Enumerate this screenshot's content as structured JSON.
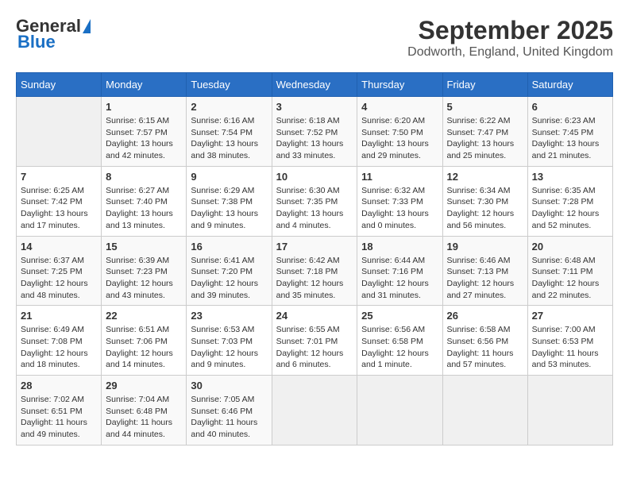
{
  "logo": {
    "general": "General",
    "blue": "Blue"
  },
  "title": "September 2025",
  "subtitle": "Dodworth, England, United Kingdom",
  "days_header": [
    "Sunday",
    "Monday",
    "Tuesday",
    "Wednesday",
    "Thursday",
    "Friday",
    "Saturday"
  ],
  "weeks": [
    [
      {
        "day": "",
        "empty": true
      },
      {
        "day": "1",
        "sunrise": "Sunrise: 6:15 AM",
        "sunset": "Sunset: 7:57 PM",
        "daylight": "Daylight: 13 hours and 42 minutes."
      },
      {
        "day": "2",
        "sunrise": "Sunrise: 6:16 AM",
        "sunset": "Sunset: 7:54 PM",
        "daylight": "Daylight: 13 hours and 38 minutes."
      },
      {
        "day": "3",
        "sunrise": "Sunrise: 6:18 AM",
        "sunset": "Sunset: 7:52 PM",
        "daylight": "Daylight: 13 hours and 33 minutes."
      },
      {
        "day": "4",
        "sunrise": "Sunrise: 6:20 AM",
        "sunset": "Sunset: 7:50 PM",
        "daylight": "Daylight: 13 hours and 29 minutes."
      },
      {
        "day": "5",
        "sunrise": "Sunrise: 6:22 AM",
        "sunset": "Sunset: 7:47 PM",
        "daylight": "Daylight: 13 hours and 25 minutes."
      },
      {
        "day": "6",
        "sunrise": "Sunrise: 6:23 AM",
        "sunset": "Sunset: 7:45 PM",
        "daylight": "Daylight: 13 hours and 21 minutes."
      }
    ],
    [
      {
        "day": "7",
        "sunrise": "Sunrise: 6:25 AM",
        "sunset": "Sunset: 7:42 PM",
        "daylight": "Daylight: 13 hours and 17 minutes."
      },
      {
        "day": "8",
        "sunrise": "Sunrise: 6:27 AM",
        "sunset": "Sunset: 7:40 PM",
        "daylight": "Daylight: 13 hours and 13 minutes."
      },
      {
        "day": "9",
        "sunrise": "Sunrise: 6:29 AM",
        "sunset": "Sunset: 7:38 PM",
        "daylight": "Daylight: 13 hours and 9 minutes."
      },
      {
        "day": "10",
        "sunrise": "Sunrise: 6:30 AM",
        "sunset": "Sunset: 7:35 PM",
        "daylight": "Daylight: 13 hours and 4 minutes."
      },
      {
        "day": "11",
        "sunrise": "Sunrise: 6:32 AM",
        "sunset": "Sunset: 7:33 PM",
        "daylight": "Daylight: 13 hours and 0 minutes."
      },
      {
        "day": "12",
        "sunrise": "Sunrise: 6:34 AM",
        "sunset": "Sunset: 7:30 PM",
        "daylight": "Daylight: 12 hours and 56 minutes."
      },
      {
        "day": "13",
        "sunrise": "Sunrise: 6:35 AM",
        "sunset": "Sunset: 7:28 PM",
        "daylight": "Daylight: 12 hours and 52 minutes."
      }
    ],
    [
      {
        "day": "14",
        "sunrise": "Sunrise: 6:37 AM",
        "sunset": "Sunset: 7:25 PM",
        "daylight": "Daylight: 12 hours and 48 minutes."
      },
      {
        "day": "15",
        "sunrise": "Sunrise: 6:39 AM",
        "sunset": "Sunset: 7:23 PM",
        "daylight": "Daylight: 12 hours and 43 minutes."
      },
      {
        "day": "16",
        "sunrise": "Sunrise: 6:41 AM",
        "sunset": "Sunset: 7:20 PM",
        "daylight": "Daylight: 12 hours and 39 minutes."
      },
      {
        "day": "17",
        "sunrise": "Sunrise: 6:42 AM",
        "sunset": "Sunset: 7:18 PM",
        "daylight": "Daylight: 12 hours and 35 minutes."
      },
      {
        "day": "18",
        "sunrise": "Sunrise: 6:44 AM",
        "sunset": "Sunset: 7:16 PM",
        "daylight": "Daylight: 12 hours and 31 minutes."
      },
      {
        "day": "19",
        "sunrise": "Sunrise: 6:46 AM",
        "sunset": "Sunset: 7:13 PM",
        "daylight": "Daylight: 12 hours and 27 minutes."
      },
      {
        "day": "20",
        "sunrise": "Sunrise: 6:48 AM",
        "sunset": "Sunset: 7:11 PM",
        "daylight": "Daylight: 12 hours and 22 minutes."
      }
    ],
    [
      {
        "day": "21",
        "sunrise": "Sunrise: 6:49 AM",
        "sunset": "Sunset: 7:08 PM",
        "daylight": "Daylight: 12 hours and 18 minutes."
      },
      {
        "day": "22",
        "sunrise": "Sunrise: 6:51 AM",
        "sunset": "Sunset: 7:06 PM",
        "daylight": "Daylight: 12 hours and 14 minutes."
      },
      {
        "day": "23",
        "sunrise": "Sunrise: 6:53 AM",
        "sunset": "Sunset: 7:03 PM",
        "daylight": "Daylight: 12 hours and 9 minutes."
      },
      {
        "day": "24",
        "sunrise": "Sunrise: 6:55 AM",
        "sunset": "Sunset: 7:01 PM",
        "daylight": "Daylight: 12 hours and 6 minutes."
      },
      {
        "day": "25",
        "sunrise": "Sunrise: 6:56 AM",
        "sunset": "Sunset: 6:58 PM",
        "daylight": "Daylight: 12 hours and 1 minute."
      },
      {
        "day": "26",
        "sunrise": "Sunrise: 6:58 AM",
        "sunset": "Sunset: 6:56 PM",
        "daylight": "Daylight: 11 hours and 57 minutes."
      },
      {
        "day": "27",
        "sunrise": "Sunrise: 7:00 AM",
        "sunset": "Sunset: 6:53 PM",
        "daylight": "Daylight: 11 hours and 53 minutes."
      }
    ],
    [
      {
        "day": "28",
        "sunrise": "Sunrise: 7:02 AM",
        "sunset": "Sunset: 6:51 PM",
        "daylight": "Daylight: 11 hours and 49 minutes."
      },
      {
        "day": "29",
        "sunrise": "Sunrise: 7:04 AM",
        "sunset": "Sunset: 6:48 PM",
        "daylight": "Daylight: 11 hours and 44 minutes."
      },
      {
        "day": "30",
        "sunrise": "Sunrise: 7:05 AM",
        "sunset": "Sunset: 6:46 PM",
        "daylight": "Daylight: 11 hours and 40 minutes."
      },
      {
        "day": "",
        "empty": true
      },
      {
        "day": "",
        "empty": true
      },
      {
        "day": "",
        "empty": true
      },
      {
        "day": "",
        "empty": true
      }
    ]
  ]
}
